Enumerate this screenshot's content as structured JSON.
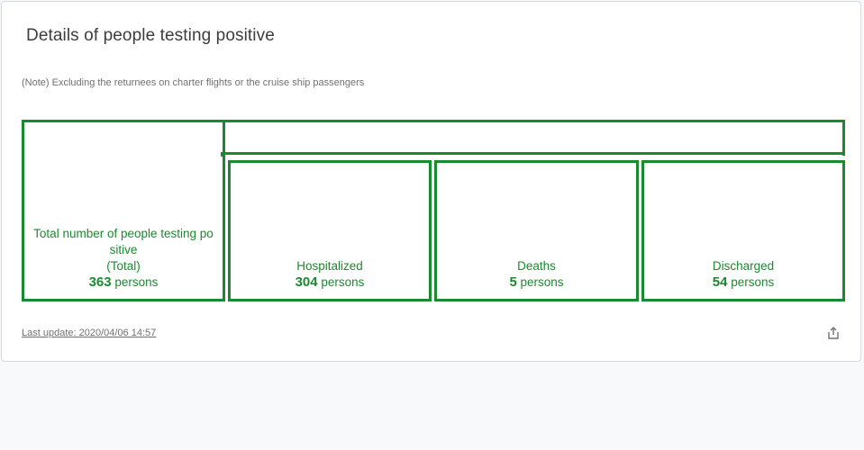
{
  "card": {
    "title": "Details of people testing positive",
    "note": "(Note) Excluding the returnees on charter flights or the cruise ship passengers",
    "last_update": "Last update: 2020/04/06 14:57",
    "share_icon": "share-icon"
  },
  "boxes": {
    "total": {
      "label": "Total number of people testing po sitive",
      "sublabel": "(Total)",
      "value": "363",
      "unit": " persons"
    },
    "hospitalized": {
      "label": "Hospitalized",
      "value": "304",
      "unit": " persons"
    },
    "deaths": {
      "label": "Deaths",
      "value": "5",
      "unit": " persons"
    },
    "discharged": {
      "label": "Discharged",
      "value": "54",
      "unit": " persons"
    }
  },
  "colors": {
    "accent": "#1a8a30",
    "text": "#3d3d3d",
    "muted": "#707070"
  }
}
